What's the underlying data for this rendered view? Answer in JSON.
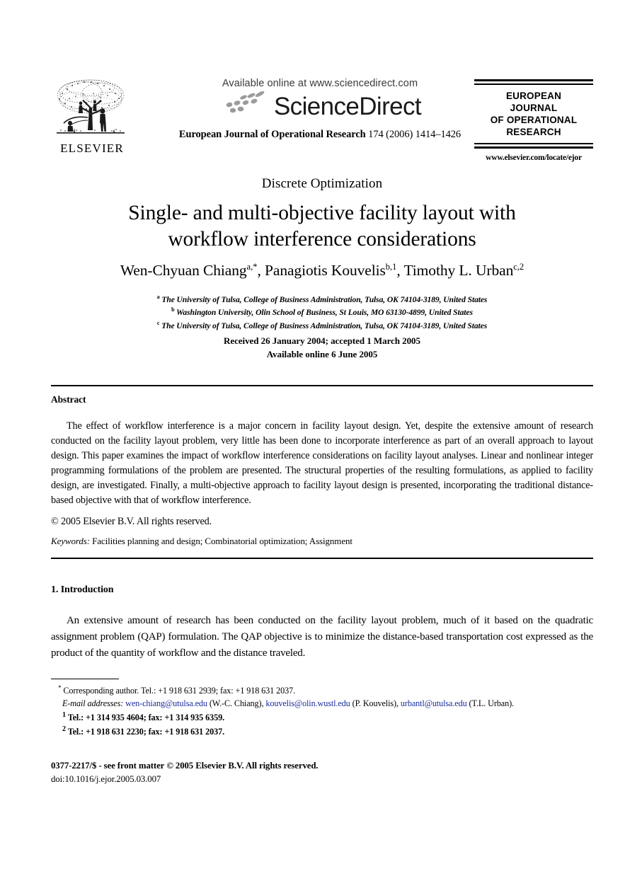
{
  "header": {
    "publisher_logo": {
      "name": "ELSEVIER",
      "icon": "elsevier-tree-logo"
    },
    "sciencedirect": {
      "available_line": "Available online at www.sciencedirect.com",
      "wordmark": "ScienceDirect",
      "swoosh_icon": "sciencedirect-swoosh-icon",
      "swoosh_color": "#9b9b9b"
    },
    "citation": {
      "journal_name": "European Journal of Operational Research",
      "volume_pages": "174 (2006) 1414–1426"
    },
    "masthead": {
      "line1": "EUROPEAN",
      "line2": "JOURNAL",
      "line3": "OF OPERATIONAL",
      "line4": "RESEARCH",
      "url": "www.elsevier.com/locate/ejor"
    }
  },
  "article": {
    "kicker": "Discrete Optimization",
    "title_line1": "Single- and multi-objective facility layout with",
    "title_line2": "workflow interference considerations",
    "authors": [
      {
        "name": "Wen-Chyuan Chiang",
        "marks": "a,*"
      },
      {
        "name": "Panagiotis Kouvelis",
        "marks": "b,1"
      },
      {
        "name": "Timothy L. Urban",
        "marks": "c,2"
      }
    ],
    "affiliations": [
      {
        "mark": "a",
        "text": "The University of Tulsa, College of Business Administration, Tulsa, OK 74104-3189, United States"
      },
      {
        "mark": "b",
        "text": "Washington University, Olin School of Business, St Louis, MO 63130-4899, United States"
      },
      {
        "mark": "c",
        "text": "The University of Tulsa, College of Business Administration, Tulsa, OK 74104-3189, United States"
      }
    ],
    "dates": {
      "received": "Received 26 January 2004; accepted 1 March 2005",
      "online": "Available online 6 June 2005"
    }
  },
  "abstract": {
    "heading": "Abstract",
    "body": "The effect of workflow interference is a major concern in facility layout design. Yet, despite the extensive amount of research conducted on the facility layout problem, very little has been done to incorporate interference as part of an overall approach to layout design. This paper examines the impact of workflow interference considerations on facility layout analyses. Linear and nonlinear integer programming formulations of the problem are presented. The structural properties of the resulting formulations, as applied to facility design, are investigated. Finally, a multi-objective approach to facility layout design is presented, incorporating the traditional distance-based objective with that of workflow interference.",
    "copyright": "© 2005 Elsevier B.V. All rights reserved."
  },
  "keywords": {
    "label": "Keywords:",
    "value": "Facilities planning and design; Combinatorial optimization; Assignment"
  },
  "introduction": {
    "heading": "1. Introduction",
    "body": "An extensive amount of research has been conducted on the facility layout problem, much of it based on the quadratic assignment problem (QAP) formulation. The QAP objective is to minimize the distance-based transportation cost expressed as the product of the quantity of workflow and the distance traveled."
  },
  "footnotes": {
    "corresponding": {
      "mark": "*",
      "text": "Corresponding author. Tel.: +1 918 631 2939; fax: +1 918 631 2037."
    },
    "email": {
      "label": "E-mail addresses:",
      "entries": [
        {
          "address": "wen-chiang@utulsa.edu",
          "owner": "(W.-C. Chiang),"
        },
        {
          "address": "kouvelis@olin.wustl.edu",
          "owner": "(P. Kouvelis),"
        },
        {
          "address": "urbantl@utulsa.edu",
          "owner": "(T.L. Urban)."
        }
      ],
      "link_color": "#1a2a9c"
    },
    "notes": [
      {
        "mark": "1",
        "text": "Tel.: +1 314 935 4604; fax: +1 314 935 6359."
      },
      {
        "mark": "2",
        "text": "Tel.: +1 918 631 2230; fax: +1 918 631 2037."
      }
    ]
  },
  "frontmatter": {
    "issn_line_prefix": "0377-2217/$ - see front matter",
    "issn_line_copyright": "© 2005 Elsevier B.V. All rights reserved.",
    "doi": "doi:10.1016/j.ejor.2005.03.007"
  }
}
